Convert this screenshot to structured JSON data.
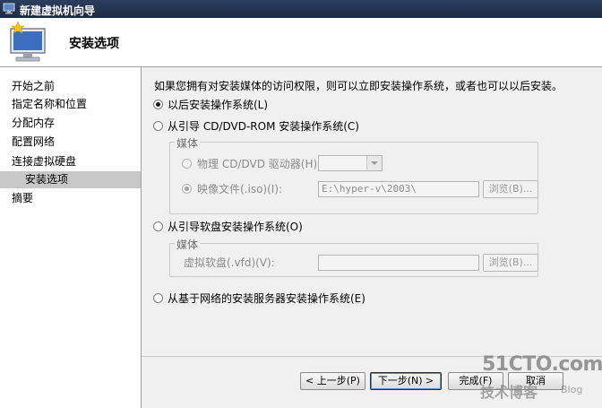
{
  "window": {
    "title": "新建虚拟机向导"
  },
  "header": {
    "page_title": "安装选项"
  },
  "nav": {
    "items": [
      {
        "label": "开始之前"
      },
      {
        "label": "指定名称和位置"
      },
      {
        "label": "分配内存"
      },
      {
        "label": "配置网络"
      },
      {
        "label": "连接虚拟硬盘"
      },
      {
        "label": "安装选项"
      },
      {
        "label": "摘要"
      }
    ],
    "selected": "安装选项"
  },
  "content": {
    "description": "如果您拥有对安装媒体的访问权限，则可以立即安装操作系统，或者也可以以后安装。",
    "option_later": {
      "label": "以后安装操作系统(L)",
      "selected": true
    },
    "option_cd": {
      "label": "从引导 CD/DVD-ROM 安装操作系统(C)",
      "selected": false,
      "group_label": "媒体",
      "physical_label": "物理 CD/DVD 驱动器(H):",
      "physical_value": "",
      "image_label": "映像文件(.iso)(I):",
      "image_value": "E:\\hyper-v\\2003\\",
      "browse_label": "浏览(B)..."
    },
    "option_floppy": {
      "label": "从引导软盘安装操作系统(O)",
      "selected": false,
      "group_label": "媒体",
      "vfd_label": "虚拟软盘(.vfd)(V):",
      "vfd_value": "",
      "browse_label": "浏览(B)..."
    },
    "option_network": {
      "label": "从基于网络的安装服务器安装操作系统(E)",
      "selected": false
    }
  },
  "footer": {
    "prev_label": "< 上一步(P)",
    "next_label": "下一步(N) >",
    "finish_label": "完成(F)",
    "cancel_label": "取消"
  },
  "watermark": {
    "main": "51CTO.com",
    "sub": "技术博客",
    "blog": "Blog"
  }
}
